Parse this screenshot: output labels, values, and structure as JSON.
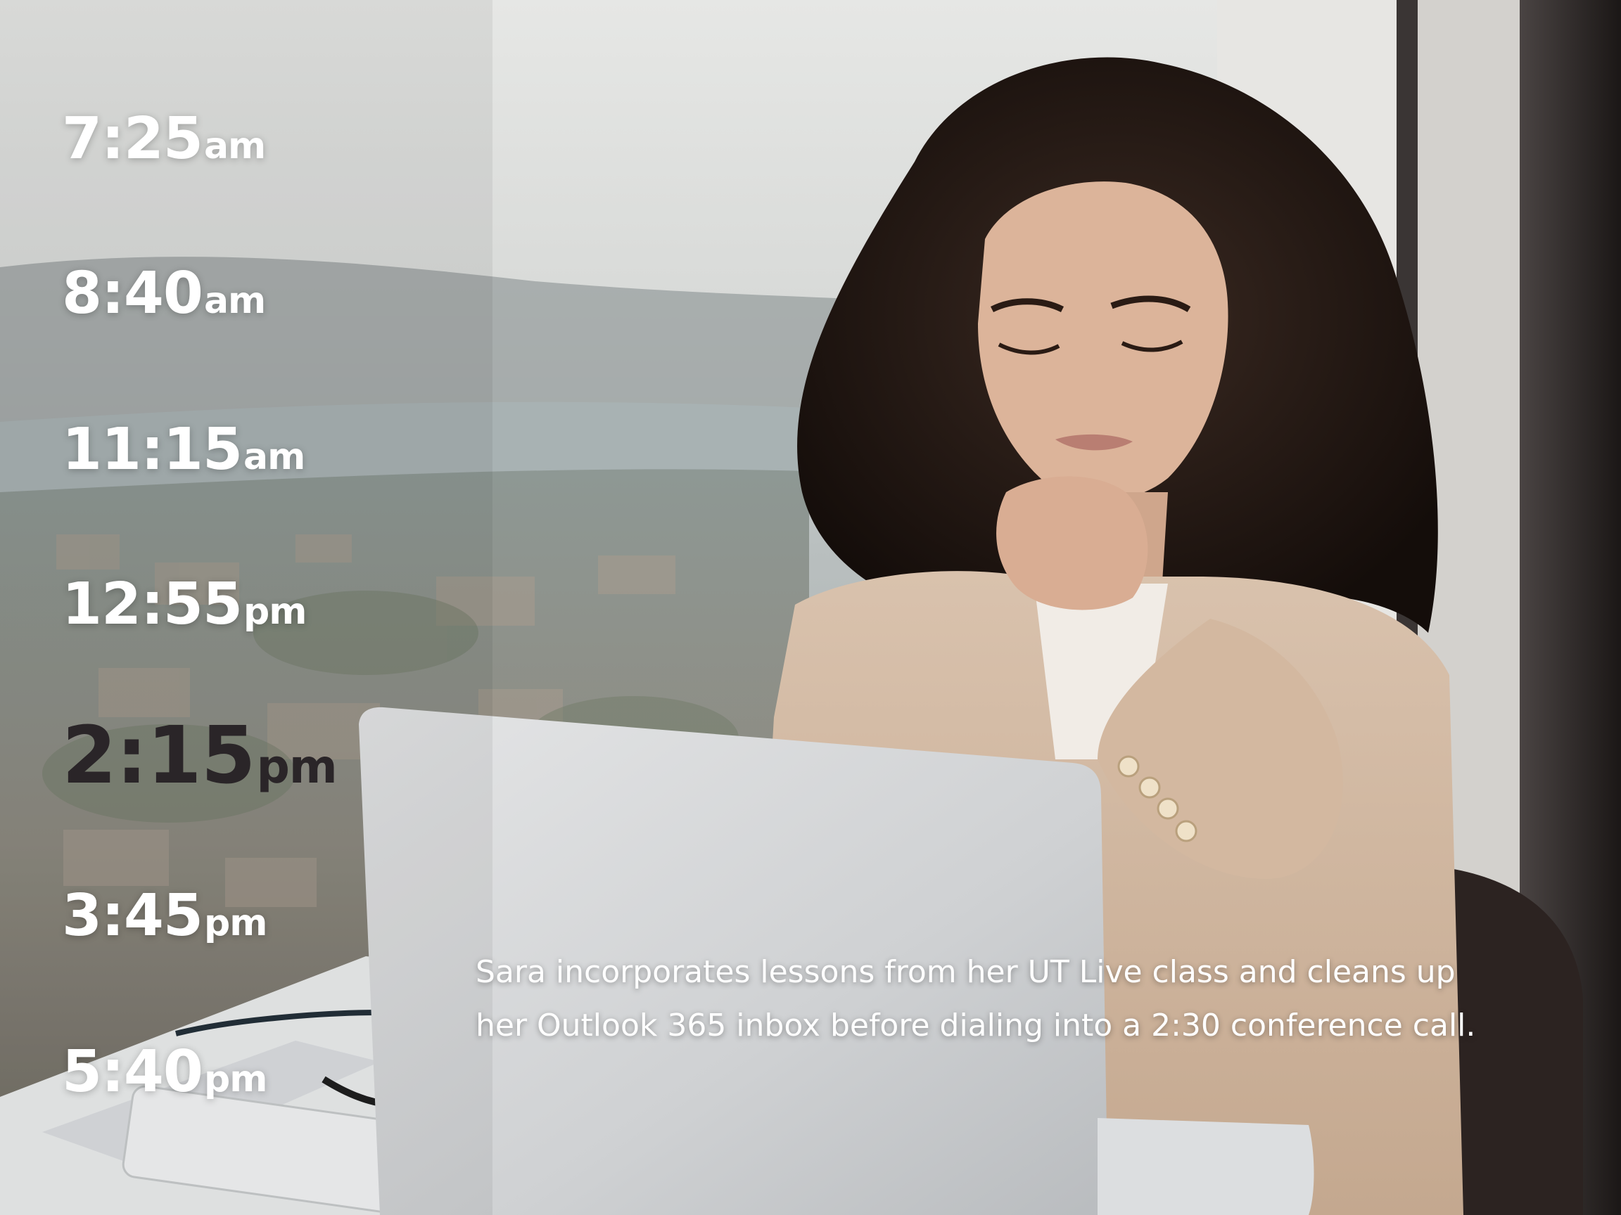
{
  "timeline": {
    "entries": [
      {
        "time": "7:25",
        "period": "am"
      },
      {
        "time": "8:40",
        "period": "am"
      },
      {
        "time": "11:15",
        "period": "am"
      },
      {
        "time": "12:55",
        "period": "pm"
      },
      {
        "time": "2:15",
        "period": "pm",
        "active": true
      },
      {
        "time": "3:45",
        "period": "pm"
      },
      {
        "time": "5:40",
        "period": "pm"
      }
    ]
  },
  "caption": {
    "line1": "Sara incorporates lessons from her UT Live class and cleans up",
    "line2": "her Outlook 365 inbox before dialing into a 2:30 conference call."
  },
  "colors": {
    "time_text": "#ffffff",
    "active_time_text": "#2a2528",
    "caption_text": "#ffffff"
  }
}
